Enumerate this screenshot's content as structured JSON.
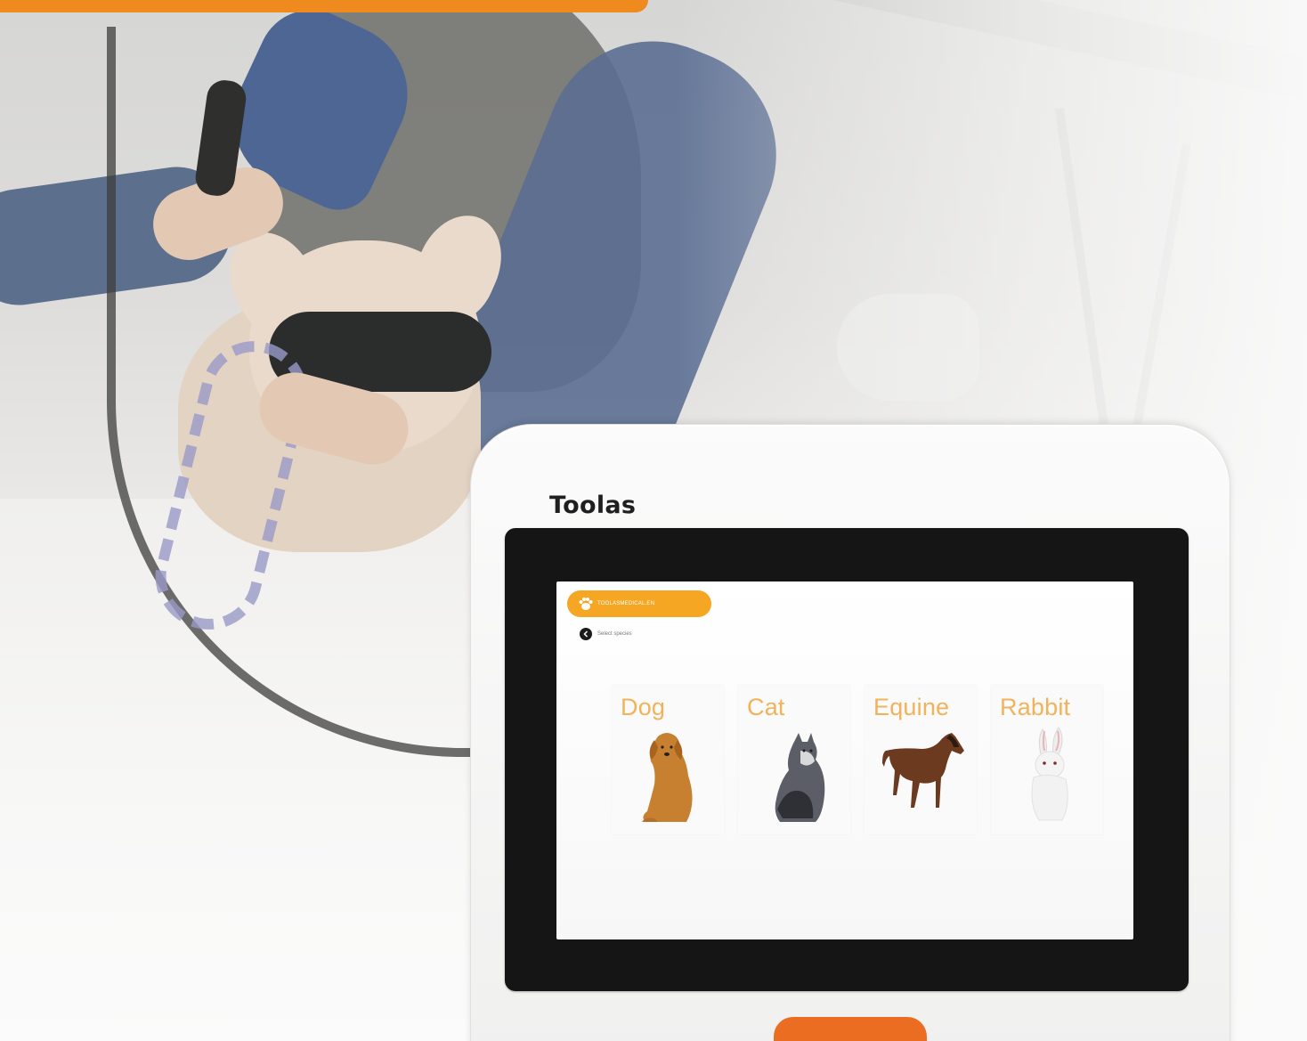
{
  "device": {
    "brand": "Toolas"
  },
  "screen": {
    "logo_text": "TOOLASMEDICAL.EN",
    "back_label": "Select species",
    "species": [
      {
        "label": "Dog",
        "icon": "dog-photo"
      },
      {
        "label": "Cat",
        "icon": "cat-photo"
      },
      {
        "label": "Equine",
        "icon": "horse-photo"
      },
      {
        "label": "Rabbit",
        "icon": "rabbit-photo"
      }
    ]
  },
  "colors": {
    "accent_orange": "#ef8a1e",
    "card_title": "#f2b259",
    "logo_pill": "#f5a623",
    "device_button": "#ea6d22",
    "bezel": "#151515"
  }
}
